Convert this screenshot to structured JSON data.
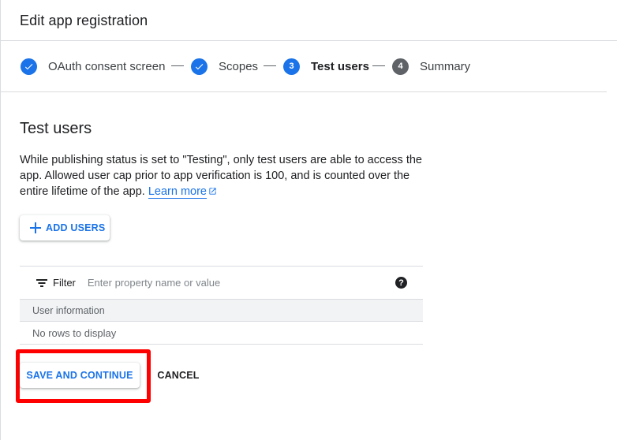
{
  "header": {
    "title": "Edit app registration"
  },
  "stepper": {
    "steps": [
      {
        "label": "OAuth consent screen",
        "state": "done",
        "number": ""
      },
      {
        "label": "Scopes",
        "state": "done",
        "number": ""
      },
      {
        "label": "Test users",
        "state": "active",
        "number": "3"
      },
      {
        "label": "Summary",
        "state": "pending",
        "number": "4"
      }
    ]
  },
  "section": {
    "title": "Test users",
    "description": "While publishing status is set to \"Testing\", only test users are able to access the app. Allowed user cap prior to app verification is 100, and is counted over the entire lifetime of the app.",
    "learn_more": "Learn more"
  },
  "add_users": {
    "label": "ADD USERS"
  },
  "table": {
    "filter_label": "Filter",
    "filter_placeholder": "Enter property name or value",
    "help_glyph": "?",
    "column_header": "User information",
    "empty_text": "No rows to display"
  },
  "actions": {
    "save_label": "SAVE AND CONTINUE",
    "cancel_label": "CANCEL"
  },
  "colors": {
    "accent": "#1a73e8",
    "highlight": "#ff0000",
    "pending": "#5f6368"
  }
}
